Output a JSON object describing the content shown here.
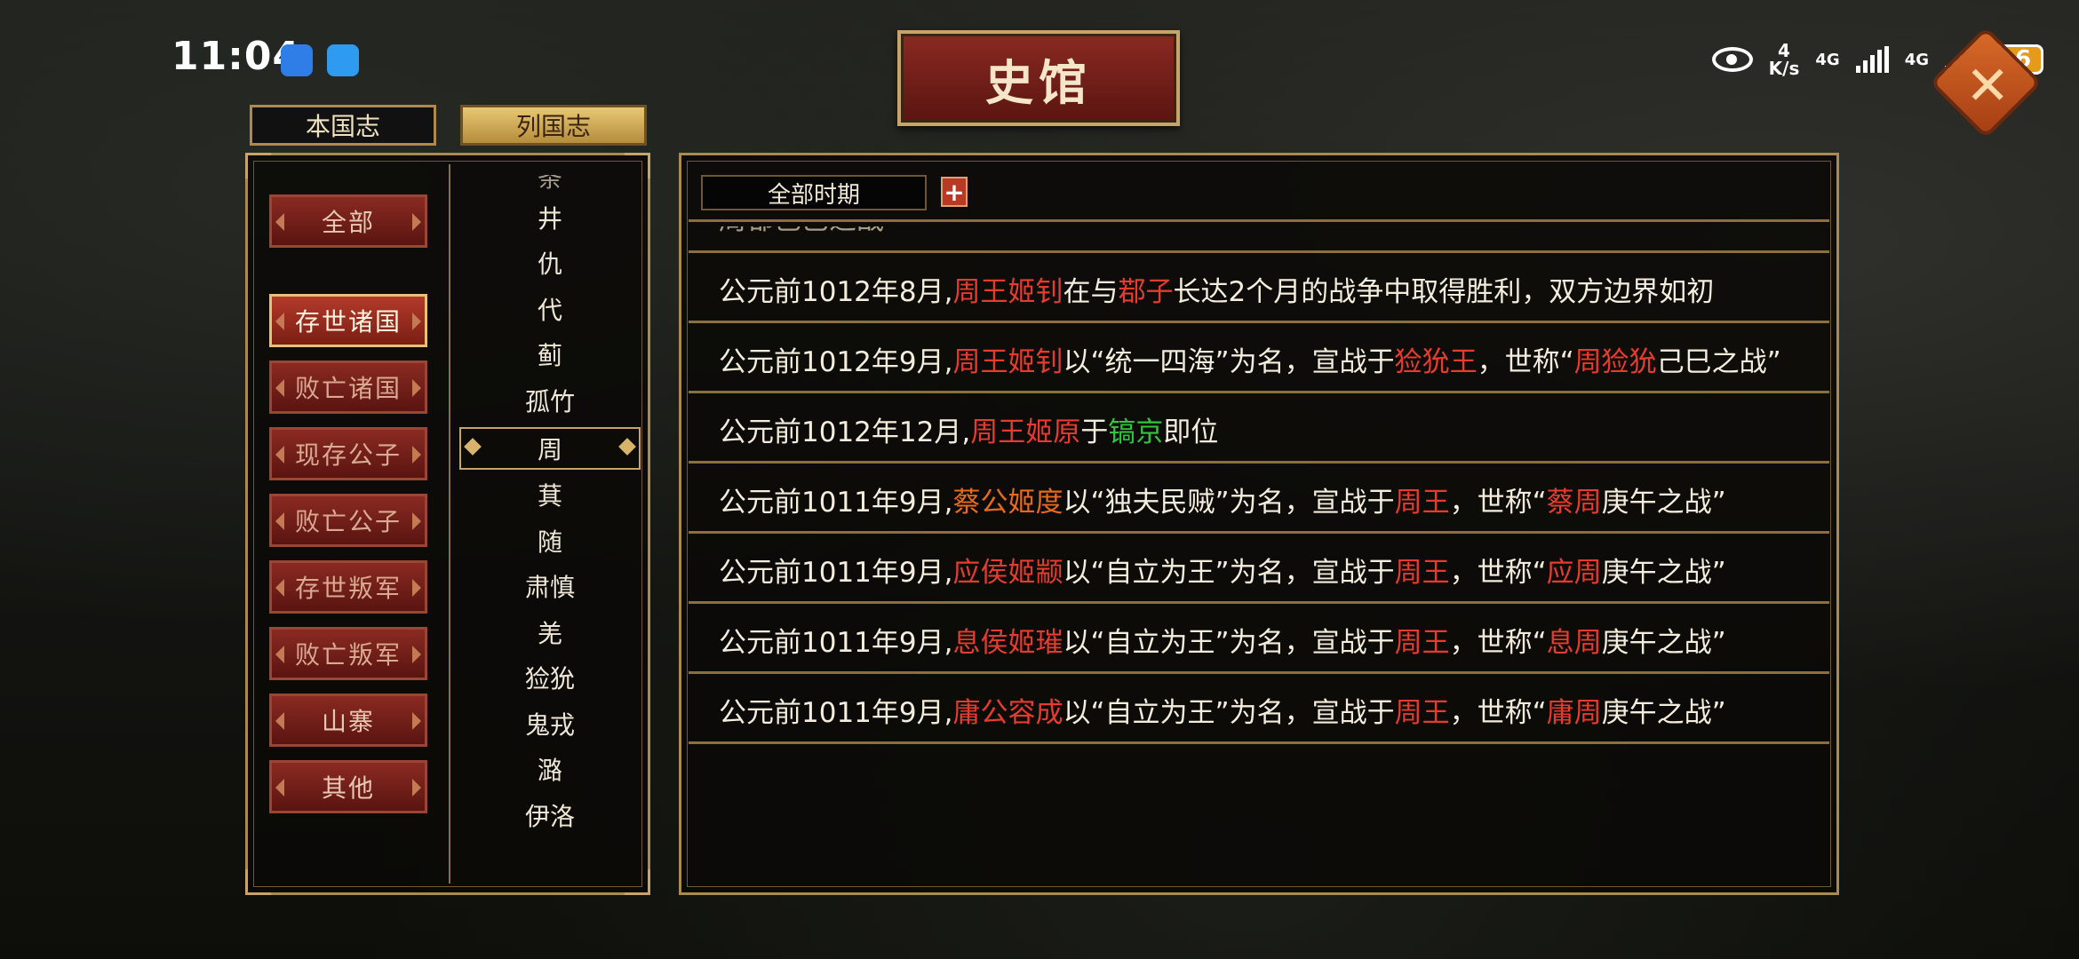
{
  "status_bar": {
    "time": "11:04",
    "speed_value": "4",
    "speed_unit": "K/s",
    "network1": "4G",
    "network2": "4G",
    "battery": "16"
  },
  "title": "史馆",
  "tabs": {
    "home": "本国志",
    "other": "列国志"
  },
  "categories": [
    "全部",
    "存世诸国",
    "败亡诸国",
    "现存公子",
    "败亡公子",
    "存世叛军",
    "败亡叛军",
    "山寨",
    "其他"
  ],
  "nations": [
    "条",
    "井",
    "仇",
    "代",
    "蓟",
    "孤竹",
    "周",
    "萁",
    "随",
    "肃慎",
    "羌",
    "猃狁",
    "鬼戎",
    "潞",
    "伊洛"
  ],
  "period_filter": "全部时期",
  "plus_label": "+",
  "events": [
    {
      "text": "周鄀己巳之战"
    },
    {
      "date": "公元前1012年8月,",
      "actor": "周王姬钊",
      "mid1": "在与",
      "target": "鄀子",
      "mid2": "长达2个月的战争中取得胜利，双方边界如初"
    },
    {
      "date": "公元前1012年9月,",
      "actor": "周王姬钊",
      "mid1": "以“统一四海”为名，宣战于",
      "target": "猃狁王",
      "mid2": "，世称“",
      "war": "周猃狁",
      "tail": "己巳之战”"
    },
    {
      "date": "公元前1012年12月,",
      "actor": "周王姬原",
      "mid1": "于",
      "place": "镐京",
      "mid2": "即位"
    },
    {
      "date": "公元前1011年9月,",
      "actor": "蔡公姬度",
      "mid1": "以“独夫民贼”为名，宣战于",
      "target": "周王",
      "mid2": "，世称“",
      "war": "蔡周",
      "tail": "庚午之战”"
    },
    {
      "date": "公元前1011年9月,",
      "actor": "应侯姬颛",
      "mid1": "以“自立为王”为名，宣战于",
      "target": "周王",
      "mid2": "，世称“",
      "war": "应周",
      "tail": "庚午之战”"
    },
    {
      "date": "公元前1011年9月,",
      "actor": "息侯姬璀",
      "mid1": "以“自立为王”为名，宣战于",
      "target": "周王",
      "mid2": "，世称“",
      "war": "息周",
      "tail": "庚午之战”"
    },
    {
      "date": "公元前1011年9月,",
      "actor": "庸公容成",
      "mid1": "以“自立为王”为名，宣战于",
      "target": "周王",
      "mid2": "，世称“",
      "war": "庸周",
      "tail": "庚午之战”"
    }
  ],
  "colors": {
    "accent_red": "#e63b2e",
    "accent_orange": "#e66a1c",
    "accent_green": "#32c43c",
    "gold_border": "#a88a52"
  }
}
